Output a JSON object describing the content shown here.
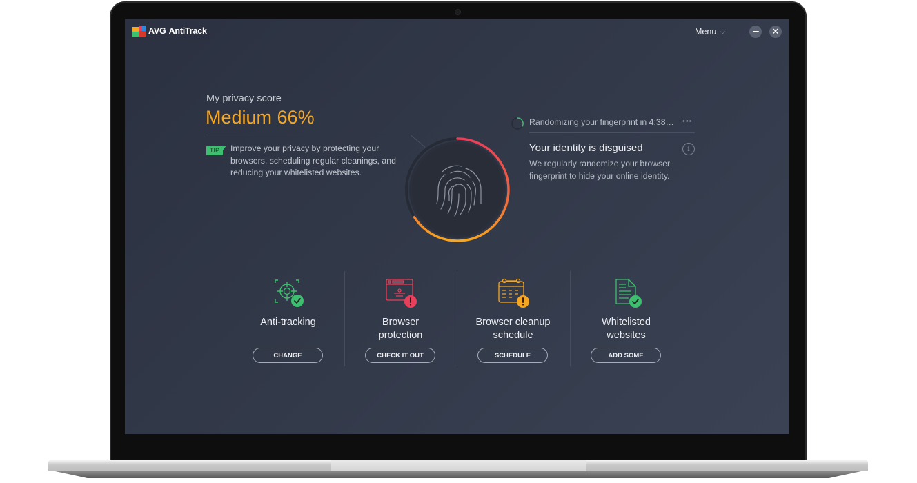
{
  "app": {
    "brand": "AVG",
    "product": "AntiTrack",
    "menu_label": "Menu",
    "menu_icon": "chevron-down-icon",
    "window_controls": [
      "minimize-icon",
      "close-icon"
    ]
  },
  "score": {
    "label": "My privacy score",
    "value": "Medium 66%",
    "percent": 66,
    "color": "#f5a623",
    "tip_badge": "TIP",
    "tip_text": "Improve your privacy by protecting your browsers, scheduling regular cleanings, and reducing your whitelisted websites."
  },
  "fingerprint": {
    "status_text": "Randomizing your fingerprint in 4:38…",
    "more_icon": "more-dots-icon",
    "title": "Your identity is disguised",
    "description": "We regularly randomize your browser fingerprint to hide your online identity.",
    "info_icon": "info-icon"
  },
  "cards": [
    {
      "label": "Anti-tracking",
      "button": "CHANGE",
      "icon": "crosshair-icon",
      "status": "ok",
      "color": "#3dbf6f"
    },
    {
      "label": "Browser protection",
      "button": "CHECK IT OUT",
      "icon": "browser-window-icon",
      "status": "warning",
      "color": "#e8405a"
    },
    {
      "label": "Browser cleanup schedule",
      "button": "SCHEDULE",
      "icon": "calendar-icon",
      "status": "warning",
      "color": "#f5a623"
    },
    {
      "label": "Whitelisted websites",
      "button": "ADD SOME",
      "icon": "document-icon",
      "status": "ok",
      "color": "#3dbf6f"
    }
  ]
}
